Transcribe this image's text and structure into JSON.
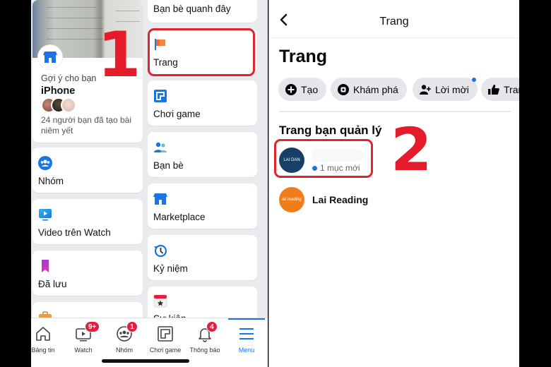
{
  "left_phone": {
    "suggestion_card": {
      "kicker": "Gợi ý cho bạn",
      "title": "iPhone",
      "description": "24 người bạn đã tạo bài niêm yết",
      "icon": "marketplace-store-icon"
    },
    "menu_left_column": [
      {
        "label": "Nhóm",
        "icon": "groups-icon"
      },
      {
        "label": "Video trên Watch",
        "icon": "watch-video-icon"
      },
      {
        "label": "Đã lưu",
        "icon": "saved-bookmark-icon"
      },
      {
        "label": "",
        "icon": "briefcase-icon"
      }
    ],
    "menu_right_column": [
      {
        "label": "Bạn bè quanh đây",
        "icon": ""
      },
      {
        "label": "Trang",
        "icon": "pages-flag-icon"
      },
      {
        "label": "Chơi game",
        "icon": "gaming-icon"
      },
      {
        "label": "Bạn bè",
        "icon": "friends-icon"
      },
      {
        "label": "Marketplace",
        "icon": "marketplace-store-icon"
      },
      {
        "label": "Kỷ niệm",
        "icon": "memories-clock-icon"
      },
      {
        "label": "Sự kiện",
        "icon": "events-calendar-icon"
      }
    ],
    "annotation_number": "1",
    "tab_bar": [
      {
        "label": "Bảng tin",
        "icon": "home-icon",
        "badge": ""
      },
      {
        "label": "Watch",
        "icon": "watch-icon",
        "badge": "9+"
      },
      {
        "label": "Nhóm",
        "icon": "groups-icon",
        "badge": "1"
      },
      {
        "label": "Chơi game",
        "icon": "gaming-icon",
        "badge": ""
      },
      {
        "label": "Thông báo",
        "icon": "bell-icon",
        "badge": "4"
      },
      {
        "label": "Menu",
        "icon": "hamburger-menu-icon",
        "badge": "",
        "active": true
      }
    ]
  },
  "right_phone": {
    "nav_title": "Trang",
    "page_heading": "Trang",
    "chips": [
      {
        "label": "Tạo",
        "icon": "plus-circle-icon"
      },
      {
        "label": "Khám phá",
        "icon": "discover-icon"
      },
      {
        "label": "Lời mời",
        "icon": "invite-person-icon",
        "notification_dot": true
      },
      {
        "label": "Trang bạn đã thích",
        "visible_label": "Trar",
        "icon": "thumbs-up-icon"
      }
    ],
    "section_title": "Trang bạn quản lý",
    "managed_pages": [
      {
        "name": "",
        "avatar_text": "LAI DAN",
        "avatar_color": "#173f67",
        "new_items": "1 mục mới"
      },
      {
        "name": "Lai Reading",
        "avatar_text": "lai reading",
        "avatar_color": "#f07d1c",
        "new_items": ""
      }
    ],
    "annotation_number": "2"
  },
  "colors": {
    "accent_blue": "#1b74e4",
    "annotation_red": "#e0242f",
    "badge_red": "#e41e3f",
    "chip_bg": "#e4e6eb",
    "menu_bg": "#e9ebee"
  }
}
